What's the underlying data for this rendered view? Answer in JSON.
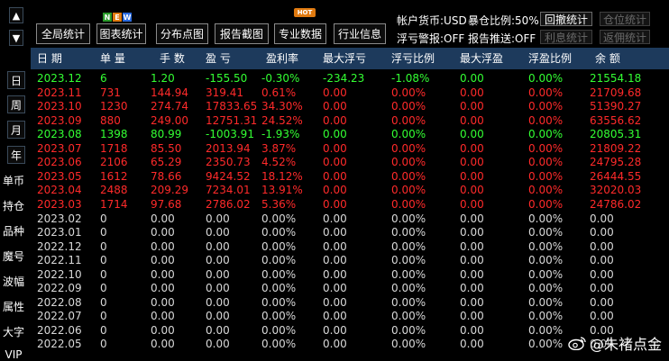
{
  "colors": {
    "up": "#ff2a2a",
    "down": "#33ff33",
    "neutral": "#d8d8d8",
    "header_bg": "#1d3a5c"
  },
  "sidebar": {
    "up_arrow": "▲",
    "down_arrow": "▼",
    "periods": [
      "日",
      "周",
      "月",
      "年"
    ],
    "items": [
      "单币",
      "持仓",
      "品种",
      "魔号",
      "波幅",
      "属性",
      "大字",
      "VIP"
    ]
  },
  "toolbar": {
    "buttons": [
      "全局统计",
      "图表统计",
      "分布点图",
      "报告截图",
      "专业数据",
      "行业信息"
    ],
    "new_badge": [
      "N",
      "E",
      "W"
    ],
    "hot_badge": "HOT",
    "account_currency": "帐户货币:USD",
    "storm_ratio": "暴仓比例:50%",
    "float_alert": "浮亏警报:OFF",
    "report_push": "报告推送:OFF",
    "right_buttons": [
      "回撤统计",
      "仓位统计",
      "利息统计",
      "返佣统计"
    ]
  },
  "table": {
    "columns": [
      "日 期",
      "单 量",
      "手 数",
      "盈 亏",
      "盈利率",
      "最大浮亏",
      "浮亏比例",
      "最大浮盈",
      "浮盈比例",
      "余 额"
    ],
    "rows": [
      {
        "date": "2023.12",
        "orders": "6",
        "lots": "1.20",
        "pnl": "-155.50",
        "rate": "-0.30%",
        "max_dd": "-234.23",
        "dd_ratio": "-1.08%",
        "max_fp": "0.00",
        "fp_ratio": "0.00%",
        "balance": "21554.18",
        "color": "down"
      },
      {
        "date": "2023.11",
        "orders": "731",
        "lots": "144.94",
        "pnl": "319.41",
        "rate": "0.61%",
        "max_dd": "0.00",
        "dd_ratio": "0.00%",
        "max_fp": "0.00",
        "fp_ratio": "0.00%",
        "balance": "21709.68",
        "color": "up"
      },
      {
        "date": "2023.10",
        "orders": "1230",
        "lots": "274.74",
        "pnl": "17833.65",
        "rate": "34.30%",
        "max_dd": "0.00",
        "dd_ratio": "0.00%",
        "max_fp": "0.00",
        "fp_ratio": "0.00%",
        "balance": "51390.27",
        "color": "up"
      },
      {
        "date": "2023.09",
        "orders": "880",
        "lots": "249.00",
        "pnl": "12751.31",
        "rate": "24.52%",
        "max_dd": "0.00",
        "dd_ratio": "0.00%",
        "max_fp": "0.00",
        "fp_ratio": "0.00%",
        "balance": "63556.62",
        "color": "up"
      },
      {
        "date": "2023.08",
        "orders": "1398",
        "lots": "80.99",
        "pnl": "-1003.91",
        "rate": "-1.93%",
        "max_dd": "0.00",
        "dd_ratio": "0.00%",
        "max_fp": "0.00",
        "fp_ratio": "0.00%",
        "balance": "20805.31",
        "color": "down"
      },
      {
        "date": "2023.07",
        "orders": "1718",
        "lots": "85.50",
        "pnl": "2013.94",
        "rate": "3.87%",
        "max_dd": "0.00",
        "dd_ratio": "0.00%",
        "max_fp": "0.00",
        "fp_ratio": "0.00%",
        "balance": "21809.22",
        "color": "up"
      },
      {
        "date": "2023.06",
        "orders": "2106",
        "lots": "65.29",
        "pnl": "2350.73",
        "rate": "4.52%",
        "max_dd": "0.00",
        "dd_ratio": "0.00%",
        "max_fp": "0.00",
        "fp_ratio": "0.00%",
        "balance": "24795.28",
        "color": "up"
      },
      {
        "date": "2023.05",
        "orders": "1612",
        "lots": "78.66",
        "pnl": "9424.52",
        "rate": "18.12%",
        "max_dd": "0.00",
        "dd_ratio": "0.00%",
        "max_fp": "0.00",
        "fp_ratio": "0.00%",
        "balance": "26444.55",
        "color": "up"
      },
      {
        "date": "2023.04",
        "orders": "2488",
        "lots": "209.29",
        "pnl": "7234.01",
        "rate": "13.91%",
        "max_dd": "0.00",
        "dd_ratio": "0.00%",
        "max_fp": "0.00",
        "fp_ratio": "0.00%",
        "balance": "32020.03",
        "color": "up"
      },
      {
        "date": "2023.03",
        "orders": "1714",
        "lots": "97.68",
        "pnl": "2786.02",
        "rate": "5.36%",
        "max_dd": "0.00",
        "dd_ratio": "0.00%",
        "max_fp": "0.00",
        "fp_ratio": "0.00%",
        "balance": "24786.02",
        "color": "up"
      },
      {
        "date": "2023.02",
        "orders": "0",
        "lots": "0.00",
        "pnl": "0.00",
        "rate": "0.00%",
        "max_dd": "0.00",
        "dd_ratio": "0.00%",
        "max_fp": "0.00",
        "fp_ratio": "0.00%",
        "balance": "0.00",
        "color": "neutral"
      },
      {
        "date": "2023.01",
        "orders": "0",
        "lots": "0.00",
        "pnl": "0.00",
        "rate": "0.00%",
        "max_dd": "0.00",
        "dd_ratio": "0.00%",
        "max_fp": "0.00",
        "fp_ratio": "0.00%",
        "balance": "0.00",
        "color": "neutral"
      },
      {
        "date": "2022.12",
        "orders": "0",
        "lots": "0.00",
        "pnl": "0.00",
        "rate": "0.00%",
        "max_dd": "0.00",
        "dd_ratio": "0.00%",
        "max_fp": "0.00",
        "fp_ratio": "0.00%",
        "balance": "0.00",
        "color": "neutral"
      },
      {
        "date": "2022.11",
        "orders": "0",
        "lots": "0.00",
        "pnl": "0.00",
        "rate": "0.00%",
        "max_dd": "0.00",
        "dd_ratio": "0.00%",
        "max_fp": "0.00",
        "fp_ratio": "0.00%",
        "balance": "0.00",
        "color": "neutral"
      },
      {
        "date": "2022.10",
        "orders": "0",
        "lots": "0.00",
        "pnl": "0.00",
        "rate": "0.00%",
        "max_dd": "0.00",
        "dd_ratio": "0.00%",
        "max_fp": "0.00",
        "fp_ratio": "0.00%",
        "balance": "0.00",
        "color": "neutral"
      },
      {
        "date": "2022.09",
        "orders": "0",
        "lots": "0.00",
        "pnl": "0.00",
        "rate": "0.00%",
        "max_dd": "0.00",
        "dd_ratio": "0.00%",
        "max_fp": "0.00",
        "fp_ratio": "0.00%",
        "balance": "0.00",
        "color": "neutral"
      },
      {
        "date": "2022.08",
        "orders": "0",
        "lots": "0.00",
        "pnl": "0.00",
        "rate": "0.00%",
        "max_dd": "0.00",
        "dd_ratio": "0.00%",
        "max_fp": "0.00",
        "fp_ratio": "0.00%",
        "balance": "0.00",
        "color": "neutral"
      },
      {
        "date": "2022.07",
        "orders": "0",
        "lots": "0.00",
        "pnl": "0.00",
        "rate": "0.00%",
        "max_dd": "0.00",
        "dd_ratio": "0.00%",
        "max_fp": "0.00",
        "fp_ratio": "0.00%",
        "balance": "0.00",
        "color": "neutral"
      },
      {
        "date": "2022.06",
        "orders": "0",
        "lots": "0.00",
        "pnl": "0.00",
        "rate": "0.00%",
        "max_dd": "0.00",
        "dd_ratio": "0.00%",
        "max_fp": "0.00",
        "fp_ratio": "0.00%",
        "balance": "0.00",
        "color": "neutral"
      },
      {
        "date": "2022.05",
        "orders": "0",
        "lots": "0.00",
        "pnl": "0.00",
        "rate": "0.00%",
        "max_dd": "0.00",
        "dd_ratio": "0.00%",
        "max_fp": "0.00",
        "fp_ratio": "0.00%",
        "balance": "0.00",
        "color": "neutral"
      }
    ]
  },
  "watermark": "@朱褚点金"
}
